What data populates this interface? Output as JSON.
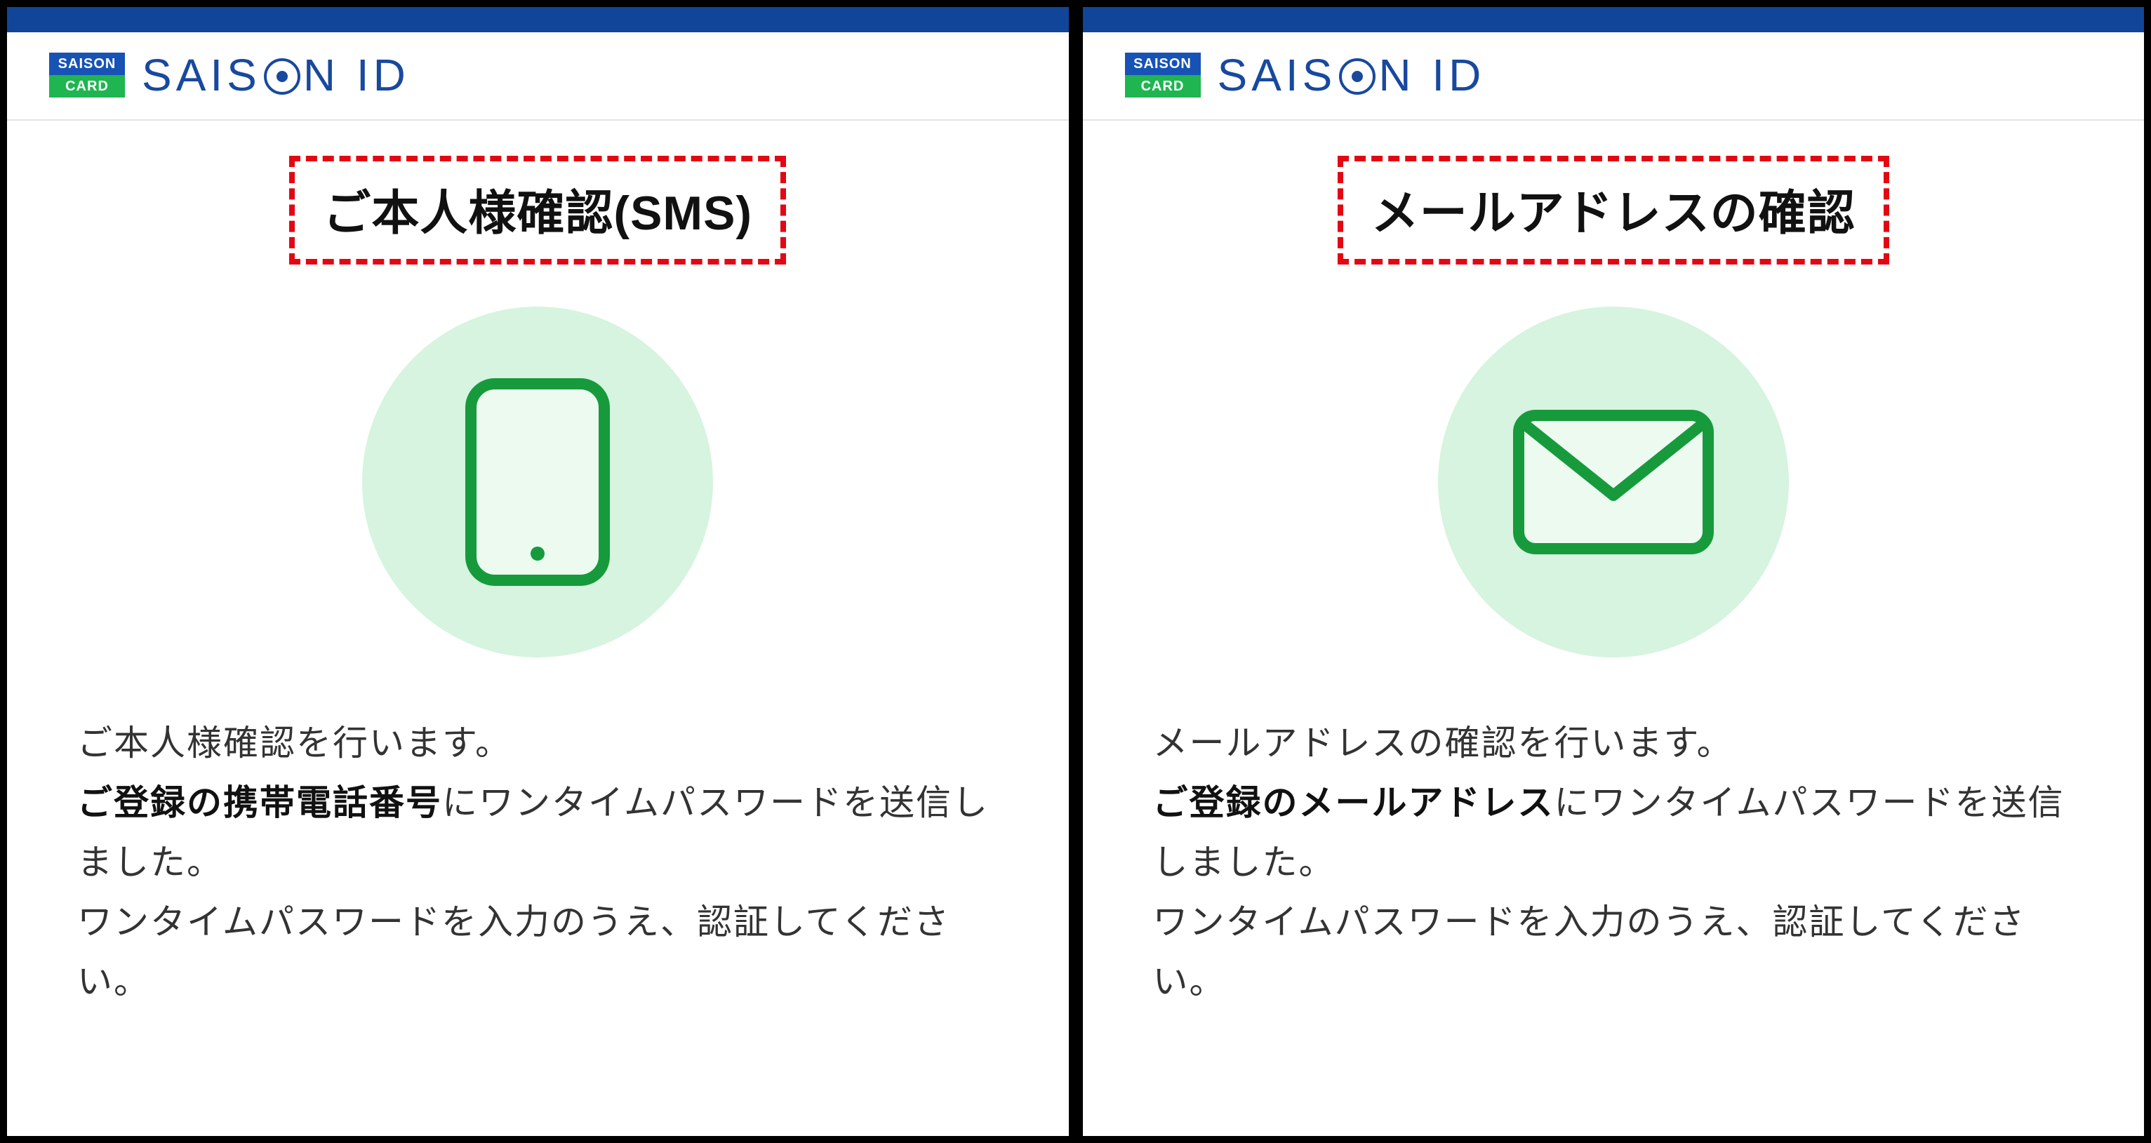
{
  "logo": {
    "top": "SAISON",
    "bottom": "CARD"
  },
  "brand_parts": {
    "p1": "SAIS",
    "p2": "N ID"
  },
  "left": {
    "headline": "ご本人様確認(SMS)",
    "desc_line1": "ご本人様確認を行います。",
    "desc_bold": "ご登録の携帯電話番号",
    "desc_after_bold": "にワンタイムパスワードを送信しました。",
    "desc_line3": "ワンタイムパスワードを入力のうえ、認証してください。"
  },
  "right": {
    "headline": "メールアドレスの確認",
    "desc_line1": "メールアドレスの確認を行います。",
    "desc_bold": "ご登録のメールアドレス",
    "desc_after_bold": "にワンタイムパスワードを送信しました。",
    "desc_line3": "ワンタイムパスワードを入力のうえ、認証してください。"
  }
}
